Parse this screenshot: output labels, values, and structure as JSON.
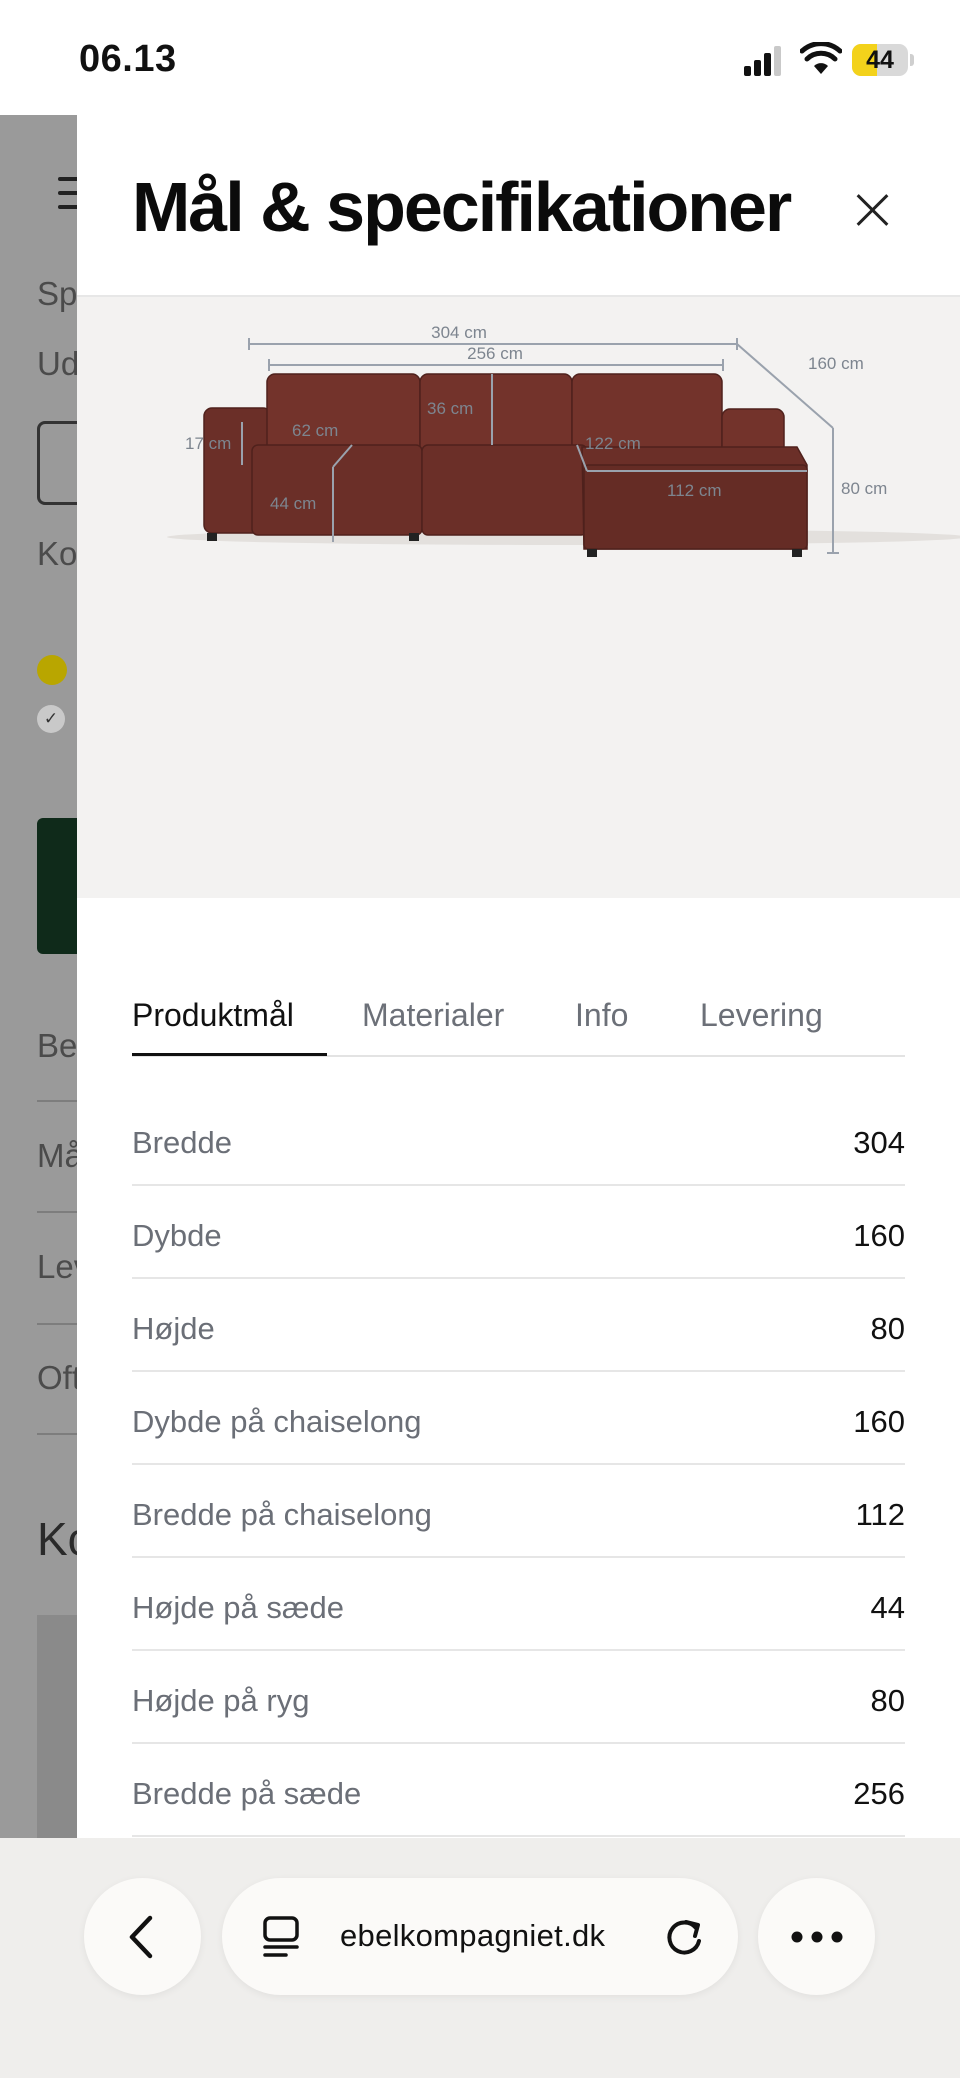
{
  "status_bar": {
    "time": "06.13",
    "battery": "44",
    "battery_level": 0.44
  },
  "background_page": {
    "fragments": [
      "Sp",
      "Ud",
      "Ko",
      "Bes",
      "Må",
      "Lev",
      "Oft",
      "Ko"
    ]
  },
  "modal": {
    "title": "Mål & specifikationer",
    "diagram": {
      "labels": [
        "304 cm",
        "256 cm",
        "160 cm",
        "36 cm",
        "62 cm",
        "17 cm",
        "122 cm",
        "44 cm",
        "112 cm",
        "80 cm"
      ],
      "sofa_color": "#6b2f28"
    },
    "tabs": [
      {
        "label": "Produktmål",
        "active": true
      },
      {
        "label": "Materialer",
        "active": false
      },
      {
        "label": "Info",
        "active": false
      },
      {
        "label": "Levering",
        "active": false
      }
    ],
    "specs": [
      {
        "label": "Bredde",
        "value": "304"
      },
      {
        "label": "Dybde",
        "value": "160"
      },
      {
        "label": "Højde",
        "value": "80"
      },
      {
        "label": "Dybde på chaiselong",
        "value": "160"
      },
      {
        "label": "Bredde på chaiselong",
        "value": "112"
      },
      {
        "label": "Højde på sæde",
        "value": "44"
      },
      {
        "label": "Højde på ryg",
        "value": "80"
      },
      {
        "label": "Bredde på sæde",
        "value": "256"
      }
    ]
  },
  "browser": {
    "url": "ebelkompagniet.dk",
    "icons": [
      "chevron-left-icon",
      "tab-overview-icon",
      "reload-icon",
      "more-icon"
    ]
  }
}
